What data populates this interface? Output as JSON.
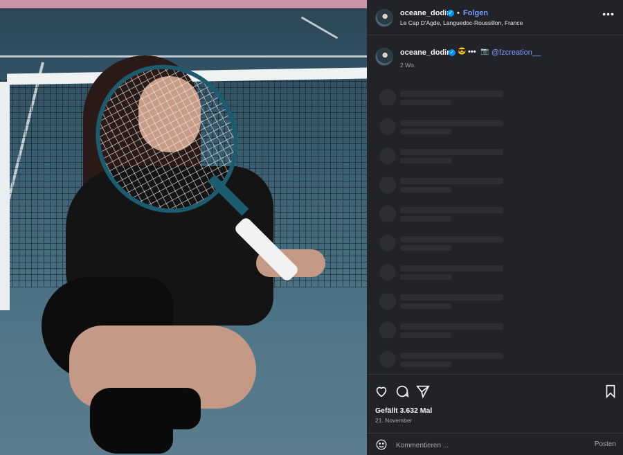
{
  "post": {
    "username": "oceane_dodin",
    "follow_label": "Folgen",
    "separator": "•",
    "location": "Le Cap D'Agde, Languedoc-Roussillon, France",
    "more_label": "•••"
  },
  "caption": {
    "username": "oceane_dodin",
    "emoji": "😎",
    "dots": "•••",
    "camera": "📷",
    "mention": "@fzcreation__",
    "time": "2 Wo."
  },
  "actions": {
    "likes": "Gefällt 3.632 Mal",
    "date": "21. November",
    "comment_placeholder": "Kommentieren ...",
    "post_label": "Posten"
  },
  "icons": {
    "verified": "verified-badge-icon",
    "like": "heart-icon",
    "comment": "comment-bubble-icon",
    "share": "paper-plane-icon",
    "save": "bookmark-icon",
    "emoji": "smiley-icon"
  },
  "colors": {
    "panel_bg": "#212328",
    "link": "#7d9cff",
    "verified": "#0095f6",
    "skeleton": "#2c2e33"
  }
}
